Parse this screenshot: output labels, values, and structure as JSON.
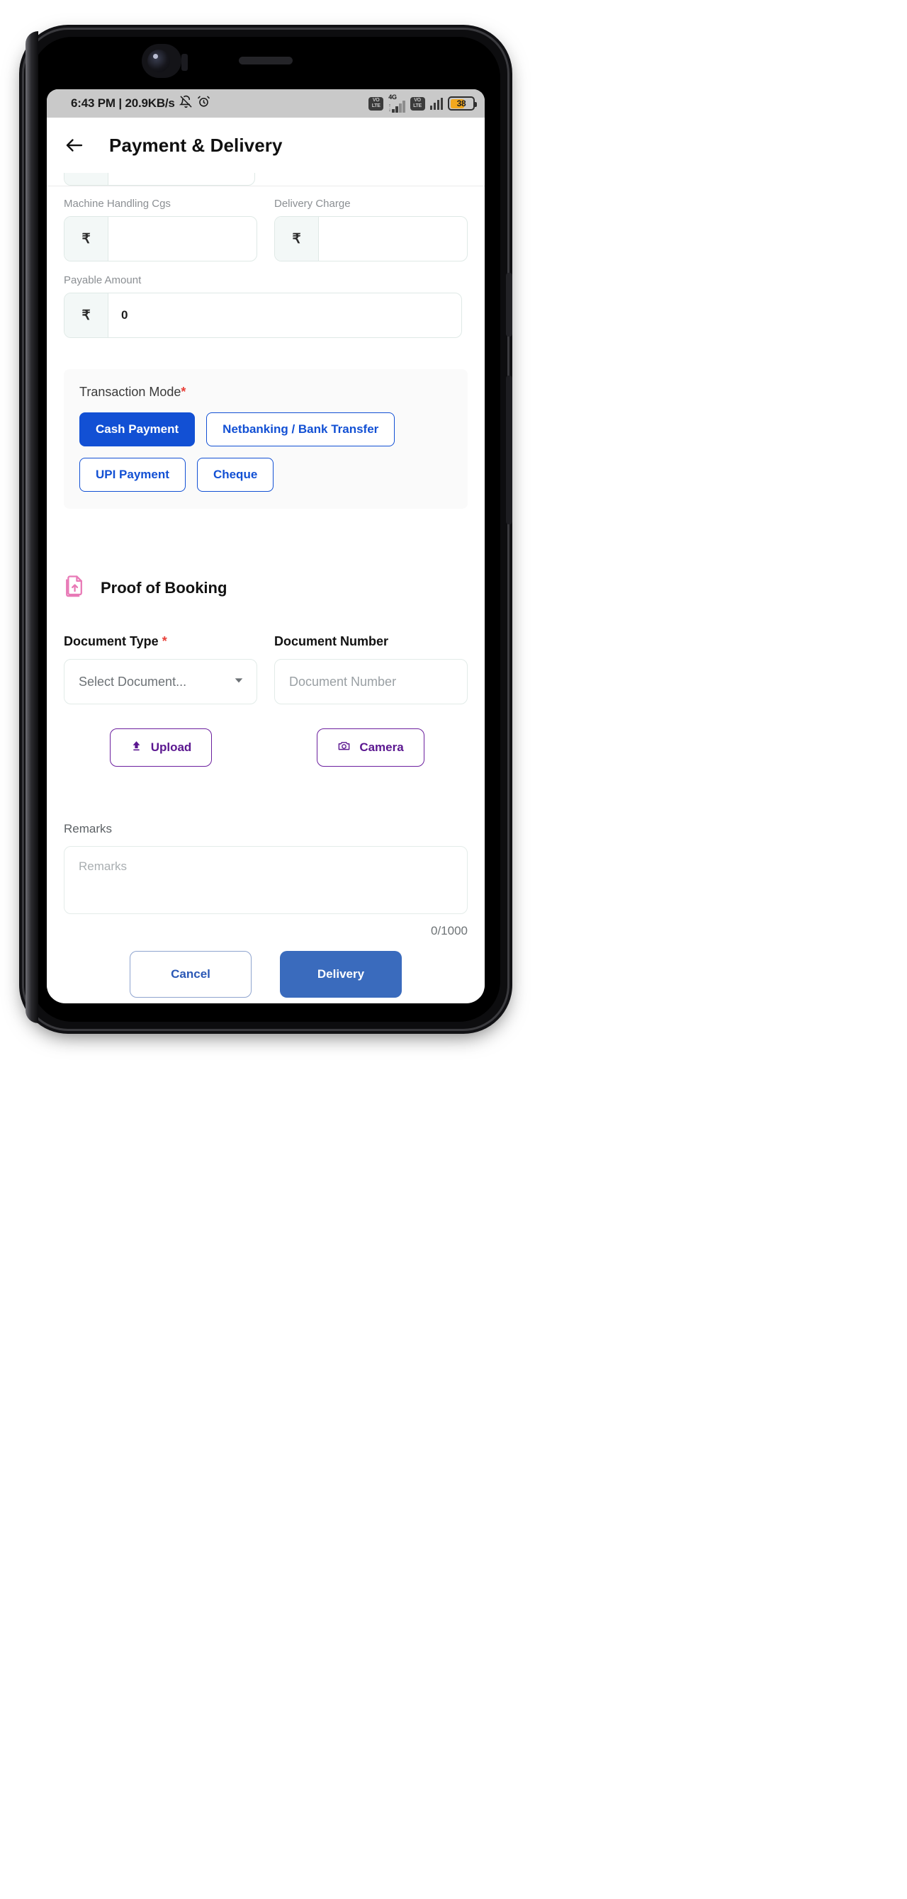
{
  "status_bar": {
    "time_and_speed": "6:43 PM | 20.9KB/s",
    "bell_icon": "bell-off-icon",
    "alarm_icon": "alarm-clock-icon",
    "volte_line1": "VO",
    "volte_line2": "LTE",
    "network_type": "4G",
    "battery_percent": "38"
  },
  "app_bar": {
    "back_icon": "back-arrow-icon",
    "title": "Payment & Delivery"
  },
  "form": {
    "machine_handling_label": "Machine Handling Cgs",
    "machine_handling_value": "",
    "delivery_charge_label": "Delivery Charge",
    "delivery_charge_value": "",
    "payable_amount_label": "Payable Amount",
    "payable_amount_value": "0",
    "currency_symbol": "₹"
  },
  "transaction_mode": {
    "label": "Transaction Mode",
    "required_marker": "*",
    "options": [
      {
        "label": "Cash Payment",
        "selected": true
      },
      {
        "label": "Netbanking / Bank Transfer",
        "selected": false
      },
      {
        "label": "UPI Payment",
        "selected": false
      },
      {
        "label": "Cheque",
        "selected": false
      }
    ],
    "selected_color": "#1250d4"
  },
  "proof_of_booking": {
    "icon": "document-upload-icon",
    "icon_color": "#e879b6",
    "title": "Proof of Booking",
    "document_type_label": "Document Type",
    "document_type_required": "*",
    "document_type_value": "Select Document...",
    "document_number_label": "Document Number",
    "document_number_placeholder": "Document Number",
    "upload_button": "Upload",
    "upload_icon": "upload-arrow-icon",
    "camera_button": "Camera",
    "camera_icon": "camera-icon",
    "button_color": "#5b1790"
  },
  "remarks": {
    "label": "Remarks",
    "placeholder": "Remarks",
    "counter": "0/1000"
  },
  "footer": {
    "cancel_label": "Cancel",
    "delivery_label": "Delivery",
    "delivery_color": "#3a6bbd"
  }
}
